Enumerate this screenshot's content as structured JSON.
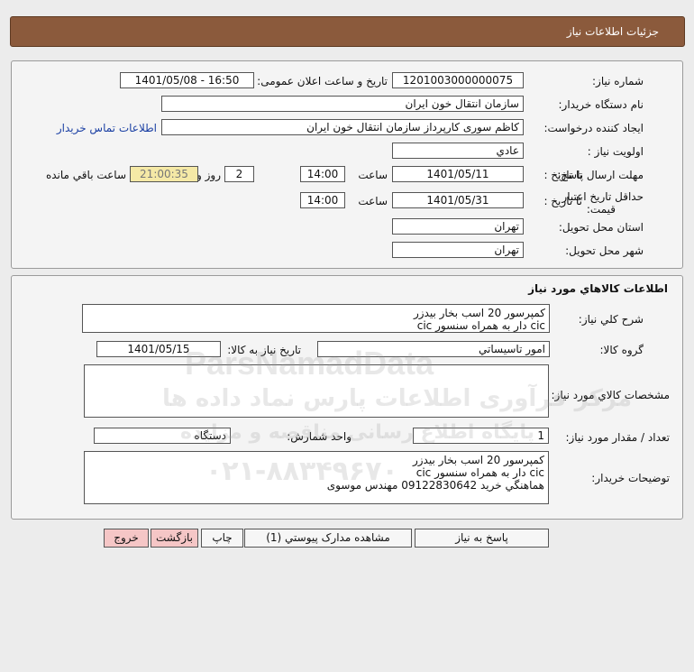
{
  "header": {
    "title": "جزئیات اطلاعات نیاز"
  },
  "info": {
    "need_number_label": "شماره نیاز:",
    "need_number": "1201003000000075",
    "announce_label": "تاریخ و ساعت اعلان عمومی:",
    "announce_value": "1401/05/08 - 16:50",
    "buyer_org_label": "نام دستگاه خریدار:",
    "buyer_org": "سازمان انتقال خون ایران",
    "creator_label": "ایجاد کننده درخواست:",
    "creator": "کاظم  سوری کارپرداز سازمان انتقال خون ایران",
    "contact_link": "اطلاعات تماس خریدار",
    "priority_label": "اولویت نیاز :",
    "priority": "عادي",
    "reply_deadline_label": "مهلت ارسال پاسخ:",
    "until_date_label": "تا تاریخ :",
    "reply_date": "1401/05/11",
    "time_label": "ساعت",
    "reply_time": "14:00",
    "days": "2",
    "days_label": "روز و",
    "remaining": "21:00:35",
    "remaining_label": "ساعت باقي مانده",
    "price_validity_label": "حداقل تاریخ اعتبار",
    "price_validity_label2": "قیمت:",
    "validity_date": "1401/05/31",
    "validity_time": "14:00",
    "delivery_province_label": "استان محل تحویل:",
    "delivery_province": "تهران",
    "delivery_city_label": "شهر محل تحویل:",
    "delivery_city": "تهران"
  },
  "goods": {
    "section_title": "اطلاعات کالاهاي مورد نیاز",
    "general_desc_label": "شرح کلي نیاز:",
    "general_desc_line1": "کمپرسور 20 اسب بخار بیدزر",
    "general_desc_line2": "cic دار به همراه سنسور cic",
    "group_label": "گروه کالا:",
    "group_value": "امور تاسیساتي",
    "need_date_label": "تاریخ نیاز به کالا:",
    "need_date": "1401/05/15",
    "specs_label": "مشخصات کالاي مورد نیاز:",
    "qty_label": "تعداد / مقدار مورد نیاز:",
    "qty": "1",
    "unit_label": "واحد شمارش:",
    "unit": "دستگاه",
    "buyer_notes_label": "توضیحات خریدار:",
    "notes_line1": "کمپرسور 20 اسب بخار بیدزر",
    "notes_line2": "cic دار به همراه سنسور cic",
    "notes_line3": "هماهنگي خرید 09122830642 مهندس موسوی"
  },
  "actions": {
    "reply": "پاسخ به نیاز",
    "attachments": "مشاهده مدارک پیوستي (1)",
    "print": "چاپ",
    "back": "بازگشت",
    "exit": "خروج"
  },
  "watermark": {
    "brand": "ParsNamadData",
    "fa_line1": "مرکز فرآوری اطلاعات پارس نماد داده ها",
    "fa_line2": "پایگاه اطلاع رسانی مناقصه و مزایده",
    "phone": "۰۲۱-۸۸۳۴۹۶۷۰"
  },
  "colors": {
    "header_bg": "#8b5a3c",
    "remaining_bg": "#f5e9a6",
    "exit_bg": "#f5c6c6",
    "link": "#1a3fa3"
  }
}
